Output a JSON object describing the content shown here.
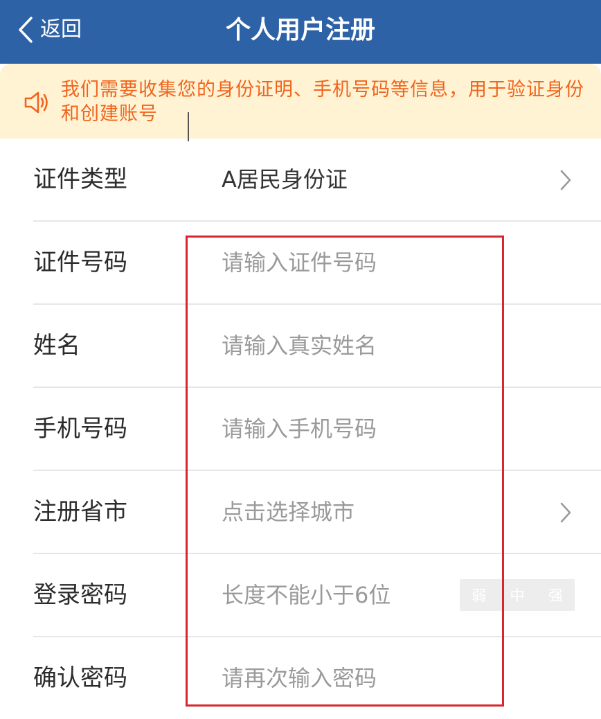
{
  "header": {
    "back_label": "返回",
    "title": "个人用户注册",
    "background": "#2d62a6"
  },
  "notice": {
    "icon": "speaker-icon",
    "text": "我们需要收集您的身份证明、手机号码等信息，用于验证身份和创建账号",
    "color": "#f0641e"
  },
  "form": {
    "id_type": {
      "label": "证件类型",
      "value": "A居民身份证"
    },
    "id_number": {
      "label": "证件号码",
      "placeholder": "请输入证件号码"
    },
    "name": {
      "label": "姓名",
      "placeholder": "请输入真实姓名"
    },
    "phone": {
      "label": "手机号码",
      "placeholder": "请输入手机号码"
    },
    "province_city": {
      "label": "注册省市",
      "placeholder": "点击选择城市"
    },
    "password": {
      "label": "登录密码",
      "placeholder": "长度不能小于6位",
      "strength": {
        "weak": "弱",
        "medium": "中",
        "strong": "强"
      }
    },
    "confirm_password": {
      "label": "确认密码",
      "placeholder": "请再次输入密码"
    }
  },
  "highlight_color": "#d7262d"
}
